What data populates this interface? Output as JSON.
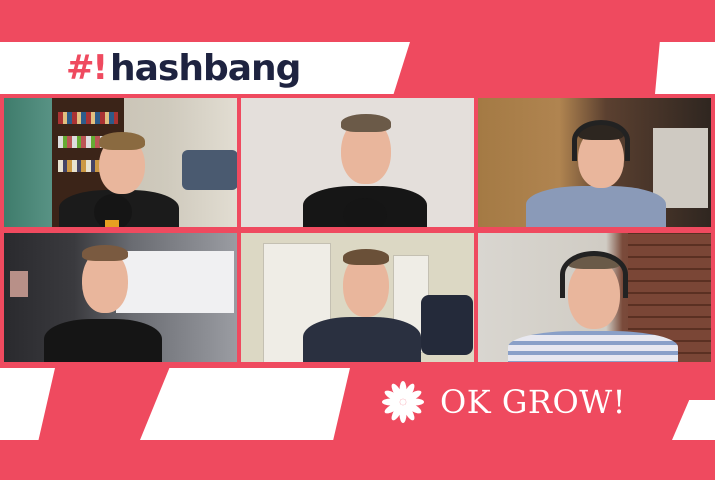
{
  "brand": {
    "mark": "#!",
    "name": "hashbang"
  },
  "sponsor": {
    "name": "OK GROW!",
    "icon": "lotus-icon"
  },
  "participants": [
    {
      "id": "p1",
      "headphones": false,
      "microphone": true
    },
    {
      "id": "p2",
      "headphones": false,
      "microphone": true
    },
    {
      "id": "p3",
      "headphones": true,
      "microphone": false
    },
    {
      "id": "p4",
      "headphones": false,
      "microphone": false
    },
    {
      "id": "p5",
      "headphones": false,
      "microphone": false
    },
    {
      "id": "p6",
      "headphones": true,
      "microphone": false
    }
  ],
  "colors": {
    "accent": "#ef4a5f",
    "logo_text": "#1e2340",
    "white": "#ffffff"
  }
}
